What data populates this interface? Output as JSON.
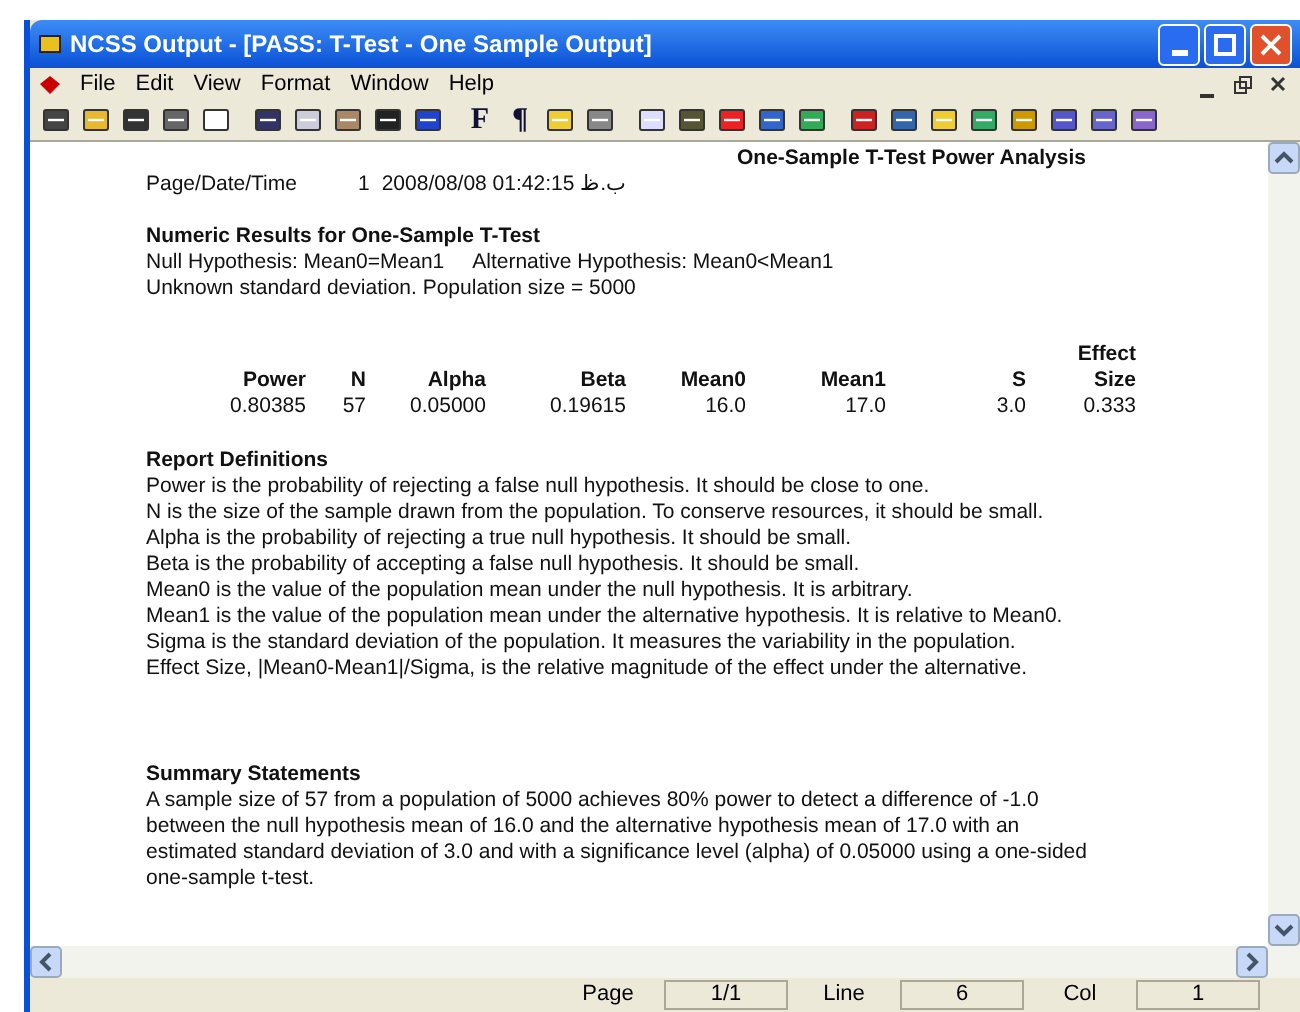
{
  "window": {
    "title": "NCSS Output - [PASS: T-Test - One Sample Output]"
  },
  "menu": [
    "File",
    "Edit",
    "View",
    "Format",
    "Window",
    "Help"
  ],
  "toolbar_glyphs": [
    "F",
    "¶"
  ],
  "report": {
    "title": "One-Sample T-Test Power Analysis",
    "page_label": "Page/Date/Time",
    "page": "1",
    "datetime": "2008/08/08 01:42:15 ب.ظ",
    "numeric_heading": "Numeric Results for One-Sample T-Test",
    "null_hypothesis": "Null Hypothesis: Mean0=Mean1",
    "alt_hypothesis": "Alternative Hypothesis: Mean0<Mean1",
    "population_note": "Unknown standard deviation. Population size = 5000",
    "table": {
      "columns": [
        {
          "label": "Power"
        },
        {
          "label": "N"
        },
        {
          "label": "Alpha"
        },
        {
          "label": "Beta"
        },
        {
          "label": "Mean0"
        },
        {
          "label": "Mean1"
        },
        {
          "label": "S"
        },
        {
          "top": "Effect",
          "label": "Size"
        }
      ],
      "rows": [
        [
          "0.80385",
          "57",
          "0.05000",
          "0.19615",
          "16.0",
          "17.0",
          "3.0",
          "0.333"
        ]
      ]
    },
    "definitions_heading": "Report Definitions",
    "definitions": [
      "Power is the probability of rejecting a false null hypothesis. It should be close to one.",
      "N is the size of the sample drawn from the population. To conserve resources, it should be small.",
      "Alpha is the probability of rejecting a true null hypothesis. It should be small.",
      "Beta is the probability of accepting a false null hypothesis. It should be small.",
      "Mean0 is the value of the population mean under the null hypothesis. It is arbitrary.",
      "Mean1 is the value of the population mean under the alternative hypothesis. It is relative to Mean0.",
      "Sigma is the standard deviation of the population. It measures the variability in the population.",
      "Effect Size, |Mean0-Mean1|/Sigma, is the relative magnitude of the effect under the alternative."
    ],
    "summary_heading": "Summary Statements",
    "summary": "A sample size of 57 from a population of 5000 achieves 80% power to detect a difference of -1.0 between the null hypothesis mean of 16.0 and the alternative hypothesis mean of 17.0 with an estimated standard deviation of 3.0 and with a significance level (alpha) of 0.05000 using a one-sided one-sample t-test."
  },
  "status_bar": [
    {
      "label": "Page",
      "value": "1/1"
    },
    {
      "label": "Line",
      "value": "6"
    },
    {
      "label": "Col",
      "value": "1"
    }
  ]
}
